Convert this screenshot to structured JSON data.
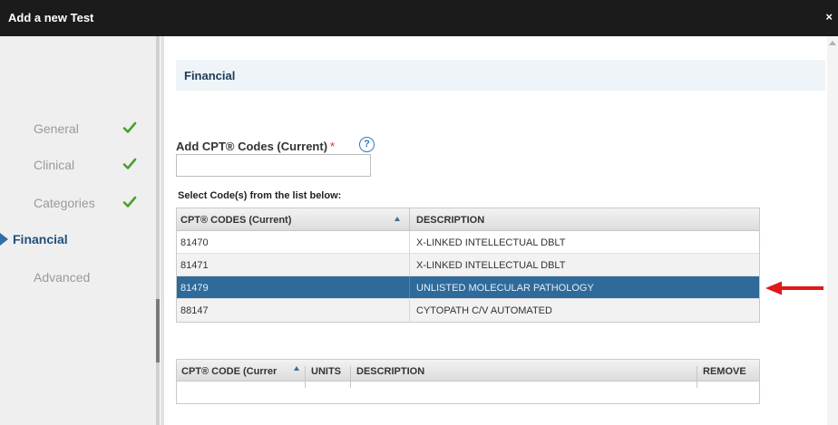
{
  "dialog": {
    "title": "Add a new Test",
    "close_glyph": "×"
  },
  "sidebar": {
    "items": [
      {
        "label": "General",
        "status": "complete"
      },
      {
        "label": "Clinical",
        "status": "complete"
      },
      {
        "label": "Categories",
        "status": "complete"
      },
      {
        "label": "Financial",
        "status": "active"
      },
      {
        "label": "Advanced",
        "status": "pending"
      }
    ]
  },
  "section": {
    "title": "Financial"
  },
  "cpt_field": {
    "label": "Add CPT® Codes (Current)",
    "required_marker": "*",
    "help_glyph": "?",
    "value": "",
    "placeholder": ""
  },
  "code_list": {
    "label": "Select Code(s) from the list below:",
    "columns": [
      "CPT® CODES (Current)",
      "DESCRIPTION"
    ],
    "sort_column": "CPT® CODES (Current)",
    "sort_direction": "ascending",
    "rows": [
      {
        "code": "81470",
        "description": "X-LINKED INTELLECTUAL DBLT",
        "selected": false
      },
      {
        "code": "81471",
        "description": "X-LINKED INTELLECTUAL DBLT",
        "selected": false
      },
      {
        "code": "81479",
        "description": "UNLISTED MOLECULAR PATHOLOGY",
        "selected": true
      },
      {
        "code": "88147",
        "description": "CYTOPATH C/V AUTOMATED",
        "selected": false
      }
    ]
  },
  "selected_codes": {
    "columns": [
      "CPT® CODE (Currer",
      "UNITS",
      "DESCRIPTION",
      "REMOVE"
    ],
    "rows": []
  },
  "colors": {
    "titlebar": "#1b1b1b",
    "selected_row": "#2f6b9a",
    "check": "#4aa12f",
    "annotation_arrow": "#e01818",
    "active_nav": "#1f4f7a"
  },
  "icons": {
    "check": "check-icon",
    "help": "help-icon",
    "active_marker": "triangle-right-icon",
    "annotation": "red-arrow-icon"
  }
}
